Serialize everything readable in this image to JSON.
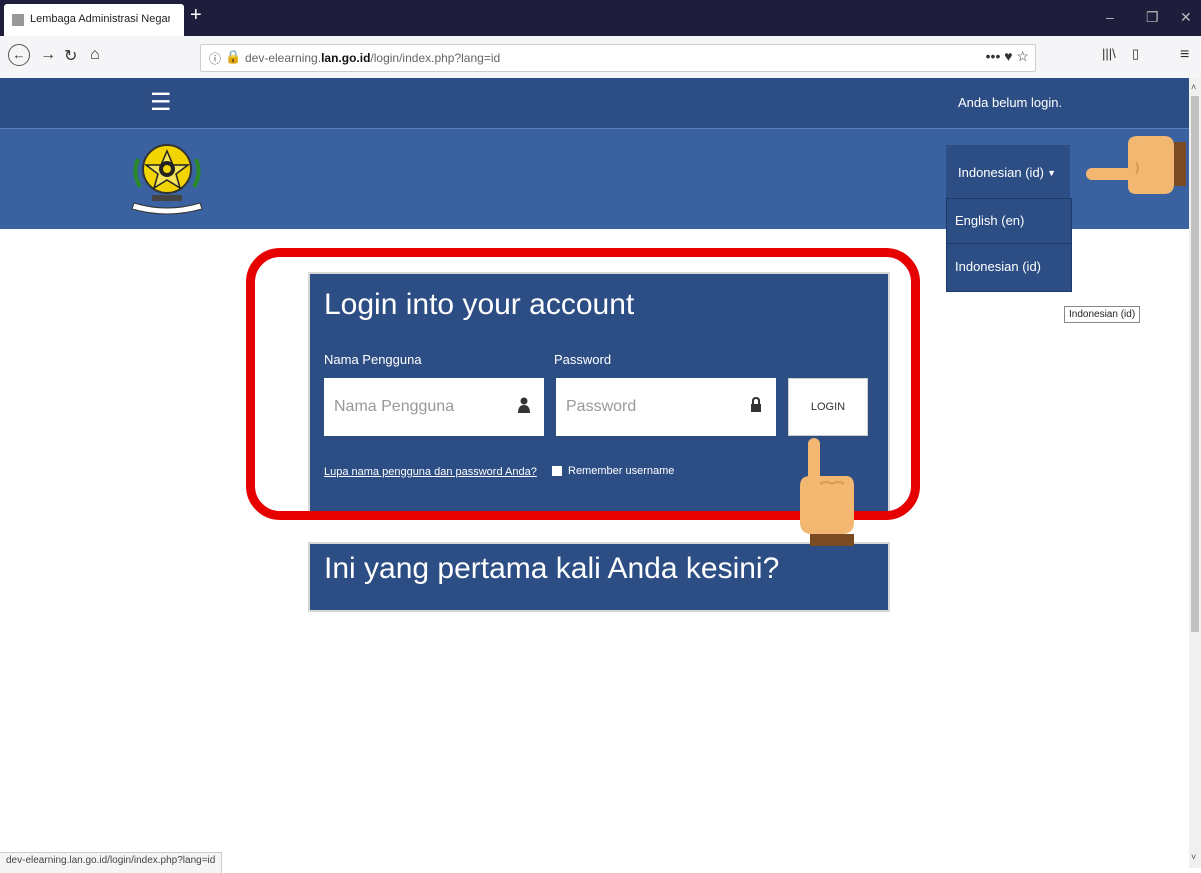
{
  "browser": {
    "tab_title": "Lembaga Administrasi Negara: X",
    "tab_close": "X",
    "new_tab": "+",
    "url_prefix": "dev-elearning.",
    "url_domain": "lan.go.id",
    "url_path": "/login/index.php?lang=id",
    "status_url": "dev-elearning.lan.go.id/login/index.php?lang=id",
    "url_actions": "••• ♥ ☆"
  },
  "page": {
    "not_logged": "Anda belum login.",
    "lang_current": "Indonesian (id)",
    "lang_options": [
      "English (en)",
      "Indonesian (id)"
    ],
    "tooltip": "Indonesian (id)",
    "login_title": "Login into your account",
    "username_label": "Nama Pengguna",
    "password_label": "Password",
    "username_placeholder": "Nama Pengguna",
    "password_placeholder": "Password",
    "login_button": "LOGIN",
    "forgot_link": "Lupa nama pengguna dan password Anda?",
    "remember": "Remember username",
    "first_time": "Ini yang pertama kali Anda kesini?"
  },
  "colors": {
    "accent": "#2d4e84",
    "header": "#3a62a0",
    "highlight_frame": "#e60000",
    "hand": "#f2b872"
  },
  "icons": {
    "back": "arrow-left-icon",
    "forward": "arrow-right-icon",
    "reload": "reload-icon",
    "home": "home-icon",
    "menu": "hamburger-icon",
    "user": "user-icon",
    "lock": "lock-icon"
  }
}
